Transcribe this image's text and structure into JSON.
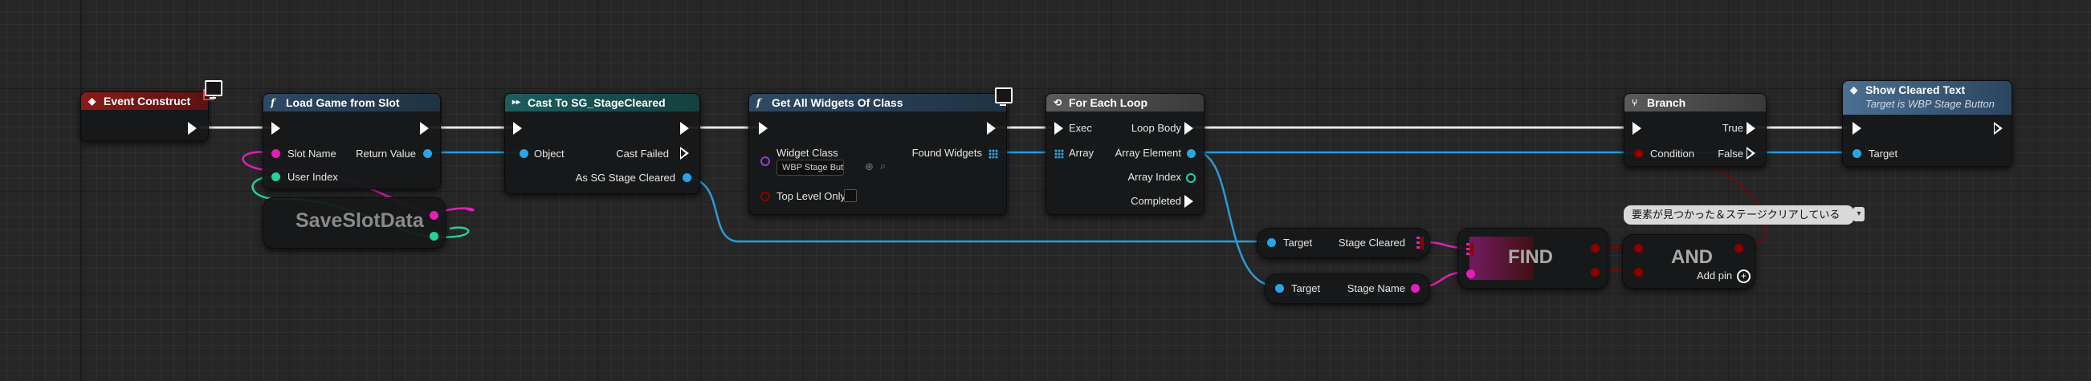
{
  "nodes": {
    "event_construct": {
      "title": "Event Construct"
    },
    "load_game": {
      "title": "Load Game from Slot",
      "pin_slot_name": "Slot Name",
      "pin_user_index": "User Index",
      "pin_return": "Return Value"
    },
    "save_slot_data": {
      "title": "SaveSlotData"
    },
    "cast": {
      "title": "Cast To SG_StageCleared",
      "pin_object": "Object",
      "pin_cast_failed": "Cast Failed",
      "pin_as": "As SG Stage Cleared"
    },
    "get_widgets": {
      "title": "Get All Widgets Of Class",
      "pin_widget_class": "Widget Class",
      "widget_class_value": "WBP Stage Butt",
      "pin_top_level": "Top Level Only",
      "pin_found": "Found Widgets"
    },
    "for_each": {
      "title": "For Each Loop",
      "pin_exec": "Exec",
      "pin_array": "Array",
      "pin_loop_body": "Loop Body",
      "pin_element": "Array Element",
      "pin_index": "Array Index",
      "pin_completed": "Completed"
    },
    "get_stage_cleared": {
      "pin_target": "Target",
      "pin_out": "Stage Cleared"
    },
    "get_stage_name": {
      "pin_target": "Target",
      "pin_out": "Stage Name"
    },
    "find": {
      "title": "FIND"
    },
    "and": {
      "title": "AND",
      "add_pin": "Add pin"
    },
    "branch": {
      "title": "Branch",
      "pin_condition": "Condition",
      "pin_true": "True",
      "pin_false": "False"
    },
    "show_cleared": {
      "title": "Show Cleared Text",
      "subtitle": "Target is WBP Stage Button",
      "pin_target": "Target"
    }
  },
  "comment": {
    "text": "要素が見つかった＆ステージクリアしている"
  },
  "icons": {
    "event": "event-diamond-icon",
    "function": "function-f-icon",
    "cast": "cast-arrows-icon",
    "loop": "loop-icon",
    "branch": "branch-icon",
    "monitor": "monitor-icon"
  },
  "colors": {
    "event_header": "#8a1a1a",
    "function_header": "#2e4a63",
    "cast_header": "#1c5e5e",
    "macro_header": "#5a5a5a",
    "exec": "#ffffff",
    "object_pin": "#2aa4e6",
    "string_pin": "#e21fb8",
    "int_pin": "#22d39a",
    "bool_pin": "#8c0000",
    "map_pin": "#e21fb8"
  }
}
